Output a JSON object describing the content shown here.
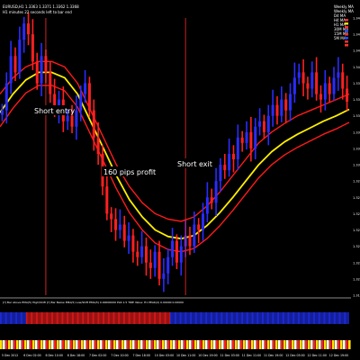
{
  "header": {
    "line1": "EURUSD,H1  1.3363 1.3371 1.3362 1.3368",
    "line2": "H1 minutes 22 seconds left to bar end"
  },
  "legend": {
    "items": [
      {
        "label": "Weekly MA",
        "color": "#ff2a2a"
      },
      {
        "label": "Weekly MA",
        "color": "#ff2a2a"
      },
      {
        "label": "D4 MA",
        "color": "#ffffff"
      },
      {
        "label": "H4 MA",
        "color": "#ffffff"
      },
      {
        "label": "H1 MA",
        "color": "#ffffff"
      },
      {
        "label": "30M MA",
        "color": "#ffffff"
      },
      {
        "label": "15M MA",
        "color": "#ffffff"
      },
      {
        "label": "5M MA",
        "color": "#ffffff"
      }
    ],
    "dots": [
      "#ff3030",
      "#ffe000",
      "#ff3030",
      "#2050ff",
      "#ff3030",
      "#2050ff",
      "#ff3030",
      "#ff3030"
    ]
  },
  "annotations": {
    "short_entry": "Short entry",
    "profit": "160 pips profit",
    "short_exit": "Short exit"
  },
  "indicator": {
    "label": "[?] Bar Above EMA(5) High/Shift [?] Bar Below EMA(5) Low/Shift EMA(5) 0.00000000 PLR 1.5 TIRE Value: H1 PEAK(2) 0.00000 0.00000"
  },
  "chart_data": {
    "type": "candlestick",
    "symbol": "EURUSD",
    "timeframe": "H1",
    "ohlc": {
      "open": 1.3363,
      "high": 1.3371,
      "low": 1.3362,
      "close": 1.3368
    },
    "price_axis": [
      "1.3445",
      "1.3430",
      "1.3415",
      "1.3400",
      "1.3385",
      "1.3370",
      "1.3355",
      "1.3340",
      "1.3325",
      "1.3310",
      "1.3295",
      "1.3280",
      "1.3265",
      "1.3250",
      "1.3235",
      "1.3220",
      "1.3205",
      "1.3190"
    ],
    "time_axis": [
      "5 Dec 2012",
      "6 Dec 02:00",
      "6 Dec 10:00",
      "6 Dec 18:00",
      "7 Dec 02:00",
      "7 Dec 10:00",
      "7 Dec 18:00",
      "10 Dec 03:00",
      "10 Dec 11:00",
      "10 Dec 19:00",
      "11 Dec 03:00",
      "11 Dec 11:00",
      "11 Dec 19:00",
      "12 Dec 03:00",
      "12 Dec 11:00",
      "12 Dec 19:00"
    ],
    "closes": [
      1.336,
      1.3385,
      1.341,
      1.3395,
      1.3425,
      1.344,
      1.343,
      1.3405,
      1.3385,
      1.341,
      1.3395,
      1.3375,
      1.336,
      1.337,
      1.335,
      1.3355,
      1.3345,
      1.336,
      1.3375,
      1.3385,
      1.336,
      1.3335,
      1.332,
      1.329,
      1.3265,
      1.326,
      1.325,
      1.3255,
      1.324,
      1.3245,
      1.323,
      1.3225,
      1.3235,
      1.322,
      1.3215,
      1.323,
      1.3205,
      1.321,
      1.3225,
      1.324,
      1.322,
      1.3235,
      1.3245,
      1.3235,
      1.3255,
      1.325,
      1.3265,
      1.328,
      1.3275,
      1.3295,
      1.331,
      1.3305,
      1.332,
      1.3315,
      1.3335,
      1.333,
      1.334,
      1.3325,
      1.3345,
      1.335,
      1.334,
      1.3355,
      1.3365,
      1.3355,
      1.337,
      1.336,
      1.3375,
      1.339,
      1.3395,
      1.3385,
      1.338,
      1.3395,
      1.3375,
      1.337,
      1.3385,
      1.3375,
      1.339,
      1.3395,
      1.338,
      1.3368
    ],
    "ma_red_upper": [
      1.3375,
      1.339,
      1.34,
      1.3405,
      1.3405,
      1.34,
      1.3385,
      1.336,
      1.3335,
      1.331,
      1.329,
      1.3275,
      1.3265,
      1.326,
      1.3258,
      1.3262,
      1.3272,
      1.3285,
      1.33,
      1.3315,
      1.333,
      1.334,
      1.3348,
      1.3355,
      1.336,
      1.3365,
      1.337,
      1.3375
    ],
    "ma_yellow": [
      1.3358,
      1.3375,
      1.3388,
      1.3395,
      1.3395,
      1.339,
      1.3375,
      1.335,
      1.3325,
      1.33,
      1.3278,
      1.3262,
      1.325,
      1.3244,
      1.3242,
      1.3245,
      1.3254,
      1.3266,
      1.328,
      1.3295,
      1.331,
      1.3322,
      1.3331,
      1.3338,
      1.3344,
      1.335,
      1.3355,
      1.3361
    ],
    "ma_red_lower": [
      1.3345,
      1.3362,
      1.3376,
      1.3383,
      1.3383,
      1.3378,
      1.3363,
      1.3338,
      1.3313,
      1.3288,
      1.3266,
      1.325,
      1.3238,
      1.3232,
      1.323,
      1.3233,
      1.3242,
      1.3254,
      1.3268,
      1.3283,
      1.3298,
      1.331,
      1.3319,
      1.3326,
      1.3332,
      1.3338,
      1.3343,
      1.3349
    ],
    "indicator_blocks": [
      "blue",
      "blue",
      "blue",
      "blue",
      "blue",
      "blue",
      "red",
      "red",
      "red",
      "red",
      "red",
      "red",
      "red",
      "red",
      "red",
      "red",
      "red",
      "red",
      "red",
      "red",
      "red",
      "red",
      "red",
      "red",
      "red",
      "red",
      "red",
      "red",
      "red",
      "red",
      "red",
      "red",
      "red",
      "red",
      "red",
      "red",
      "red",
      "red",
      "red",
      "blue",
      "blue",
      "blue",
      "blue",
      "blue",
      "blue",
      "blue",
      "blue",
      "blue",
      "blue",
      "blue",
      "blue",
      "blue",
      "blue",
      "blue",
      "blue",
      "blue",
      "blue",
      "blue",
      "blue",
      "blue",
      "blue",
      "blue",
      "blue",
      "blue",
      "blue",
      "blue",
      "blue",
      "blue",
      "blue",
      "blue",
      "blue",
      "blue",
      "blue",
      "blue",
      "blue",
      "blue",
      "blue",
      "blue",
      "blue",
      "blue"
    ],
    "signals": [
      {
        "type": "short_entry",
        "bar_index": 10
      },
      {
        "type": "short_exit",
        "bar_index": 42
      }
    ]
  }
}
